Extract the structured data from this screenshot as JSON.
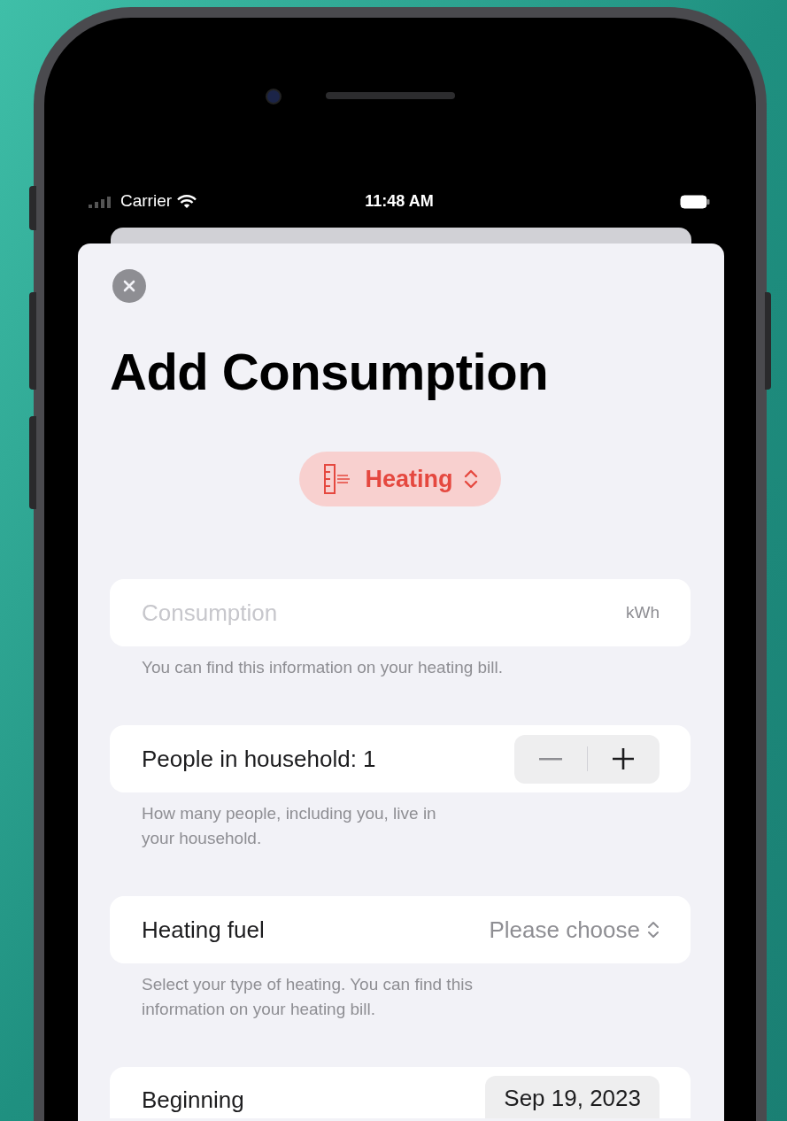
{
  "status_bar": {
    "carrier": "Carrier",
    "time": "11:48 AM"
  },
  "sheet": {
    "title": "Add Consumption",
    "category": {
      "label": "Heating"
    },
    "rows": [
      {
        "kind": "field",
        "placeholder": "Consumption",
        "unit": "kWh",
        "footnote": "You can find this information on your heating bill."
      },
      {
        "kind": "stepper",
        "label": "People in household: 1",
        "footnote": "How many people, including you, live in your household."
      },
      {
        "kind": "picker",
        "label": "Heating fuel",
        "value": "Please choose",
        "footnote": "Select your type of heating. You can find this information on your heating bill."
      },
      {
        "kind": "date",
        "label": "Beginning",
        "value": "Sep 19, 2023"
      }
    ]
  }
}
